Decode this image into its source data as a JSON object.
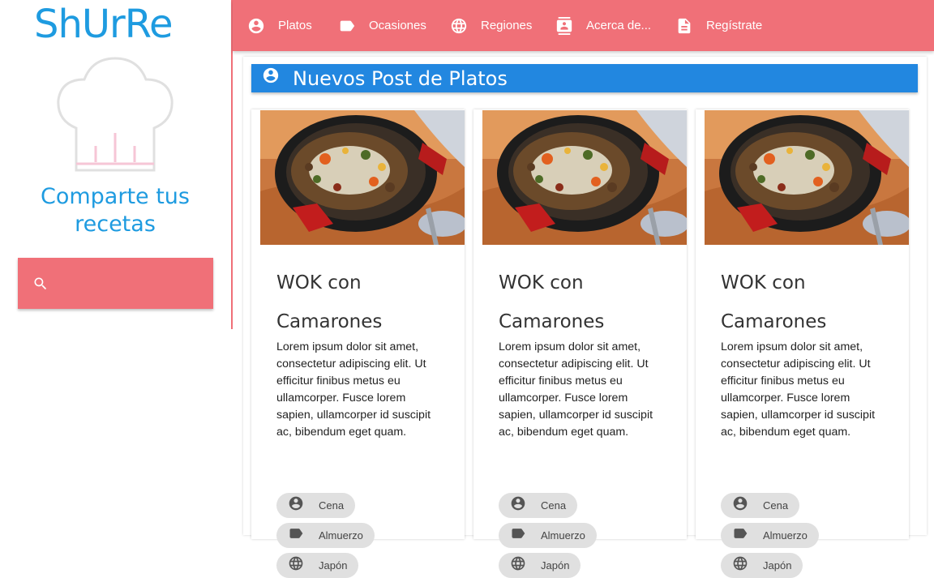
{
  "brand": {
    "logo": "ShUrRe",
    "tagline": "Comparte tus recetas"
  },
  "search": {
    "placeholder": ""
  },
  "nav": [
    {
      "label": "Platos",
      "icon": "account-circle-icon"
    },
    {
      "label": "Ocasiones",
      "icon": "label-icon"
    },
    {
      "label": "Regiones",
      "icon": "globe-icon"
    },
    {
      "label": "Acerca de...",
      "icon": "contact-card-icon"
    },
    {
      "label": "Regístrate",
      "icon": "document-icon"
    }
  ],
  "section": {
    "title": "Nuevos Post de Platos",
    "icon": "account-circle-icon"
  },
  "cards": [
    {
      "title_line1": "WOK con",
      "title_line2": "Camarones",
      "description": "Lorem ipsum dolor sit amet, consectetur adipiscing elit. Ut efficitur finibus metus eu ullamcorper. Fusce lorem sapien, ullamcorper id suscipit ac, bibendum eget quam.",
      "chips": [
        {
          "label": "Cena",
          "icon": "account-circle-icon"
        },
        {
          "label": "Almuerzo",
          "icon": "label-icon"
        },
        {
          "label": "Japón",
          "icon": "globe-icon"
        }
      ]
    },
    {
      "title_line1": "WOK con",
      "title_line2": "Camarones",
      "description": "Lorem ipsum dolor sit amet, consectetur adipiscing elit. Ut efficitur finibus metus eu ullamcorper. Fusce lorem sapien, ullamcorper id suscipit ac, bibendum eget quam.",
      "chips": [
        {
          "label": "Cena",
          "icon": "account-circle-icon"
        },
        {
          "label": "Almuerzo",
          "icon": "label-icon"
        },
        {
          "label": "Japón",
          "icon": "globe-icon"
        }
      ]
    },
    {
      "title_line1": "WOK con",
      "title_line2": "Camarones",
      "description": "Lorem ipsum dolor sit amet, consectetur adipiscing elit. Ut efficitur finibus metus eu ullamcorper. Fusce lorem sapien, ullamcorper id suscipit ac, bibendum eget quam.",
      "chips": [
        {
          "label": "Cena",
          "icon": "account-circle-icon"
        },
        {
          "label": "Almuerzo",
          "icon": "label-icon"
        },
        {
          "label": "Japón",
          "icon": "globe-icon"
        }
      ]
    }
  ],
  "colors": {
    "accent": "#f07078",
    "brand": "#1e9be0",
    "section": "#2287e0"
  }
}
